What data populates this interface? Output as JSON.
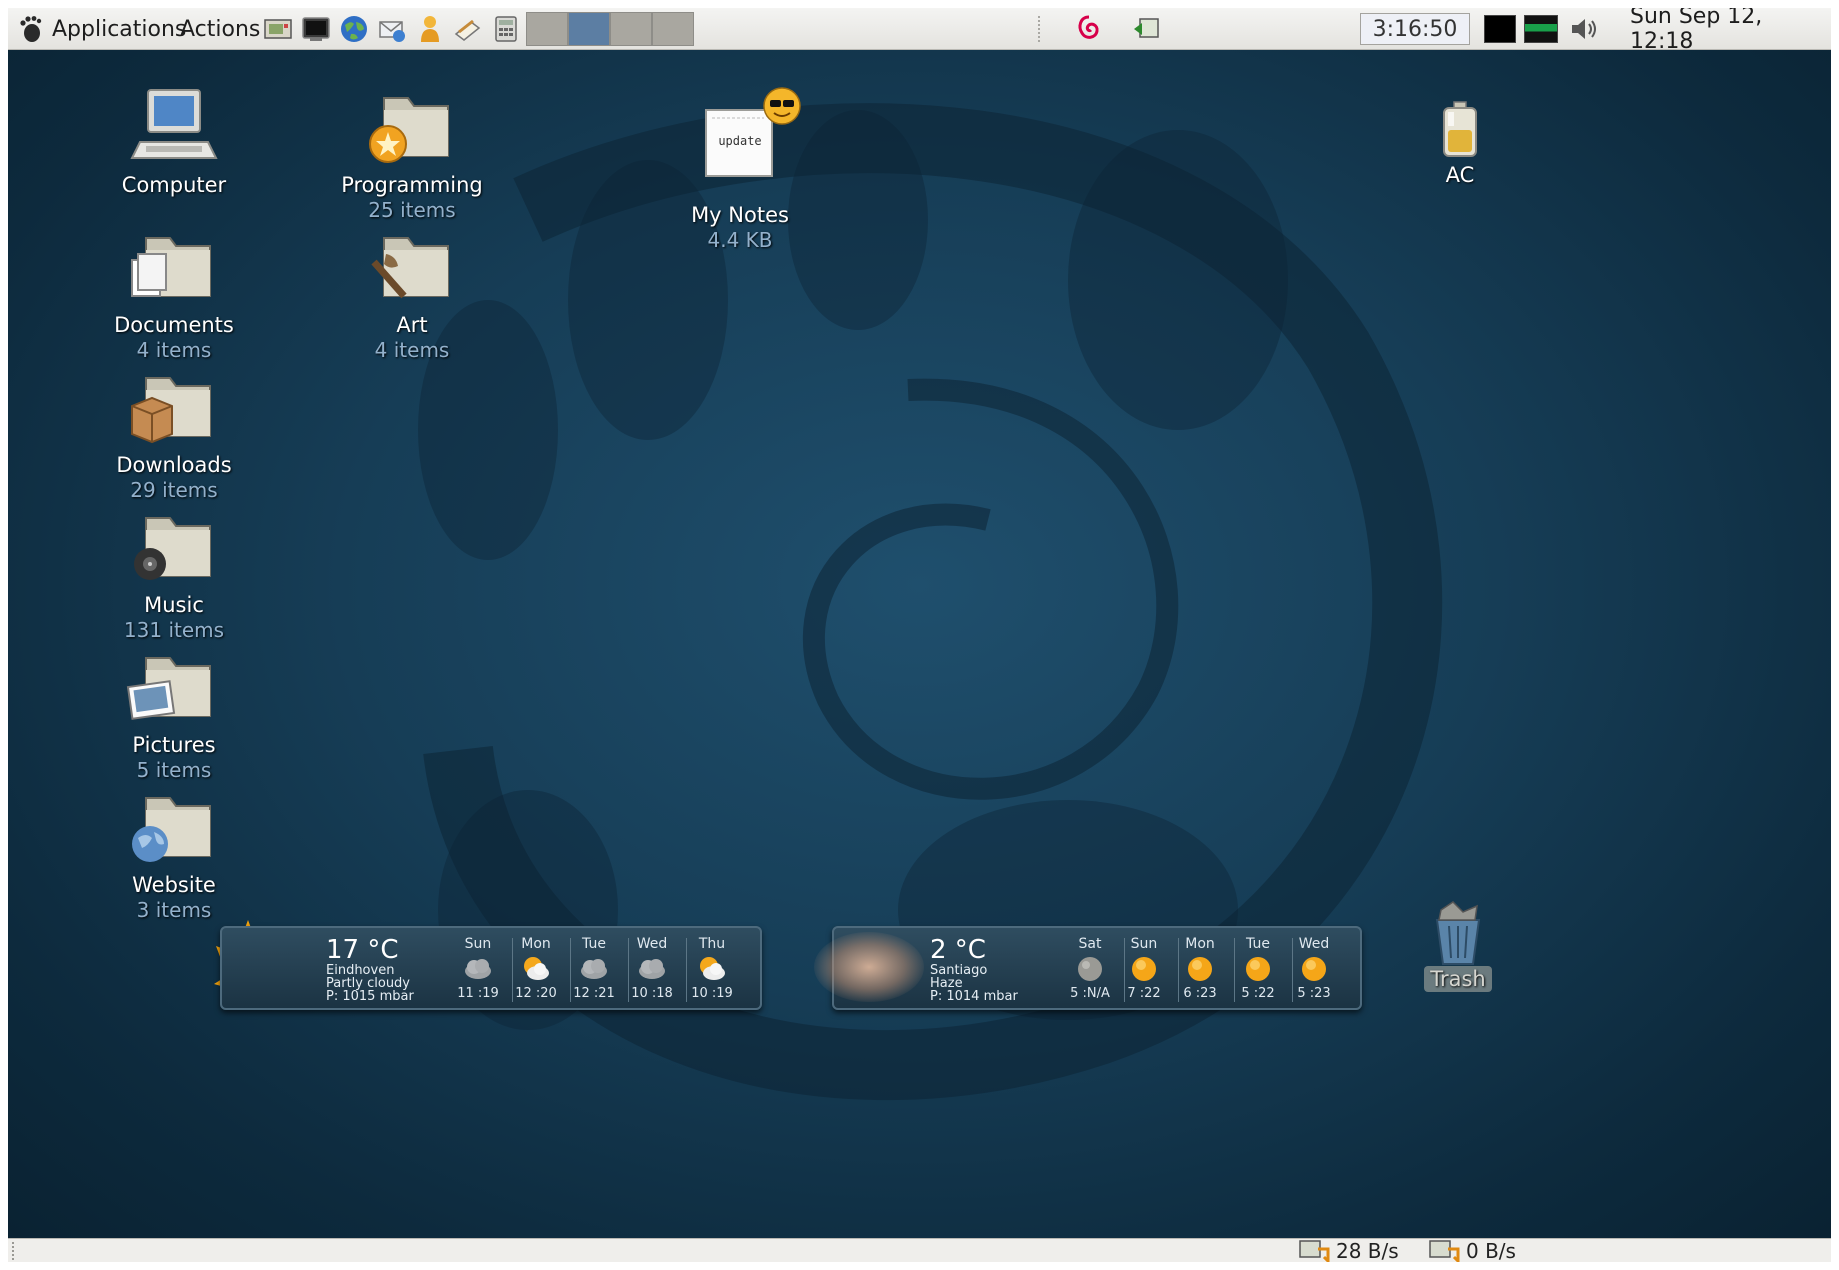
{
  "top_panel": {
    "menus": {
      "applications": "Applications",
      "actions": "Actions"
    },
    "launchers": [
      "screenshot-icon",
      "terminal-icon",
      "web-browser-icon",
      "email-icon",
      "chat-icon",
      "text-editor-icon",
      "calculator-icon"
    ],
    "workspaces": {
      "count": 4,
      "active_index": 1
    },
    "tray": {
      "debian_logo": "debian-swirl-icon",
      "clock": "3:16:50",
      "volume_icon": "speaker-icon"
    },
    "datetime": "Sun Sep 12, 12:18"
  },
  "desktop": {
    "icons": [
      {
        "id": "computer",
        "label": "Computer",
        "sub": "",
        "icon": "computer-icon"
      },
      {
        "id": "documents",
        "label": "Documents",
        "sub": "4 items",
        "icon": "documents-folder-icon"
      },
      {
        "id": "downloads",
        "label": "Downloads",
        "sub": "29 items",
        "icon": "downloads-folder-icon"
      },
      {
        "id": "music",
        "label": "Music",
        "sub": "131 items",
        "icon": "music-folder-icon"
      },
      {
        "id": "pictures",
        "label": "Pictures",
        "sub": "5 items",
        "icon": "pictures-folder-icon"
      },
      {
        "id": "website",
        "label": "Website",
        "sub": "3 items",
        "icon": "website-folder-icon"
      },
      {
        "id": "programming",
        "label": "Programming",
        "sub": "25 items",
        "icon": "programming-folder-icon"
      },
      {
        "id": "art",
        "label": "Art",
        "sub": "4 items",
        "icon": "art-folder-icon"
      },
      {
        "id": "mynotes",
        "label": "My Notes",
        "sub": "4.4 KB",
        "icon": "text-file-icon",
        "file_text": "update"
      },
      {
        "id": "ac",
        "label": "AC",
        "sub": "",
        "icon": "battery-icon"
      },
      {
        "id": "trash",
        "label": "Trash",
        "sub": "",
        "icon": "trash-icon"
      }
    ]
  },
  "weather": [
    {
      "temp": "17 °C",
      "city": "Eindhoven",
      "condition": "Partly cloudy",
      "pressure": "P: 1015 mbar",
      "current_icon": "sun-cloud-icon",
      "forecast": [
        {
          "day": "Sun",
          "range": "11 :19",
          "icon": "cloudy-icon"
        },
        {
          "day": "Mon",
          "range": "12 :20",
          "icon": "partly-cloudy-icon"
        },
        {
          "day": "Tue",
          "range": "12 :21",
          "icon": "cloudy-icon"
        },
        {
          "day": "Wed",
          "range": "10 :18",
          "icon": "cloudy-icon"
        },
        {
          "day": "Thu",
          "range": "10 :19",
          "icon": "partly-cloudy-icon"
        }
      ]
    },
    {
      "temp": "2 °C",
      "city": "Santiago",
      "condition": "Haze",
      "pressure": "P: 1014 mbar",
      "current_icon": "haze-icon",
      "forecast": [
        {
          "day": "Sat",
          "range": "5 :N/A",
          "icon": "moon-icon"
        },
        {
          "day": "Sun",
          "range": "7 :22",
          "icon": "sun-icon"
        },
        {
          "day": "Mon",
          "range": "6 :23",
          "icon": "sun-icon"
        },
        {
          "day": "Tue",
          "range": "5 :22",
          "icon": "sun-icon"
        },
        {
          "day": "Wed",
          "range": "5 :23",
          "icon": "sun-icon"
        }
      ]
    }
  ],
  "bottom_panel": {
    "net_down": "28 B/s",
    "net_up": "0 B/s"
  },
  "colors": {
    "desktop": "#163d56",
    "panel": "#e9e8e4",
    "subtitle": "#93b1cc",
    "workspace_active": "#5c7ea3"
  }
}
